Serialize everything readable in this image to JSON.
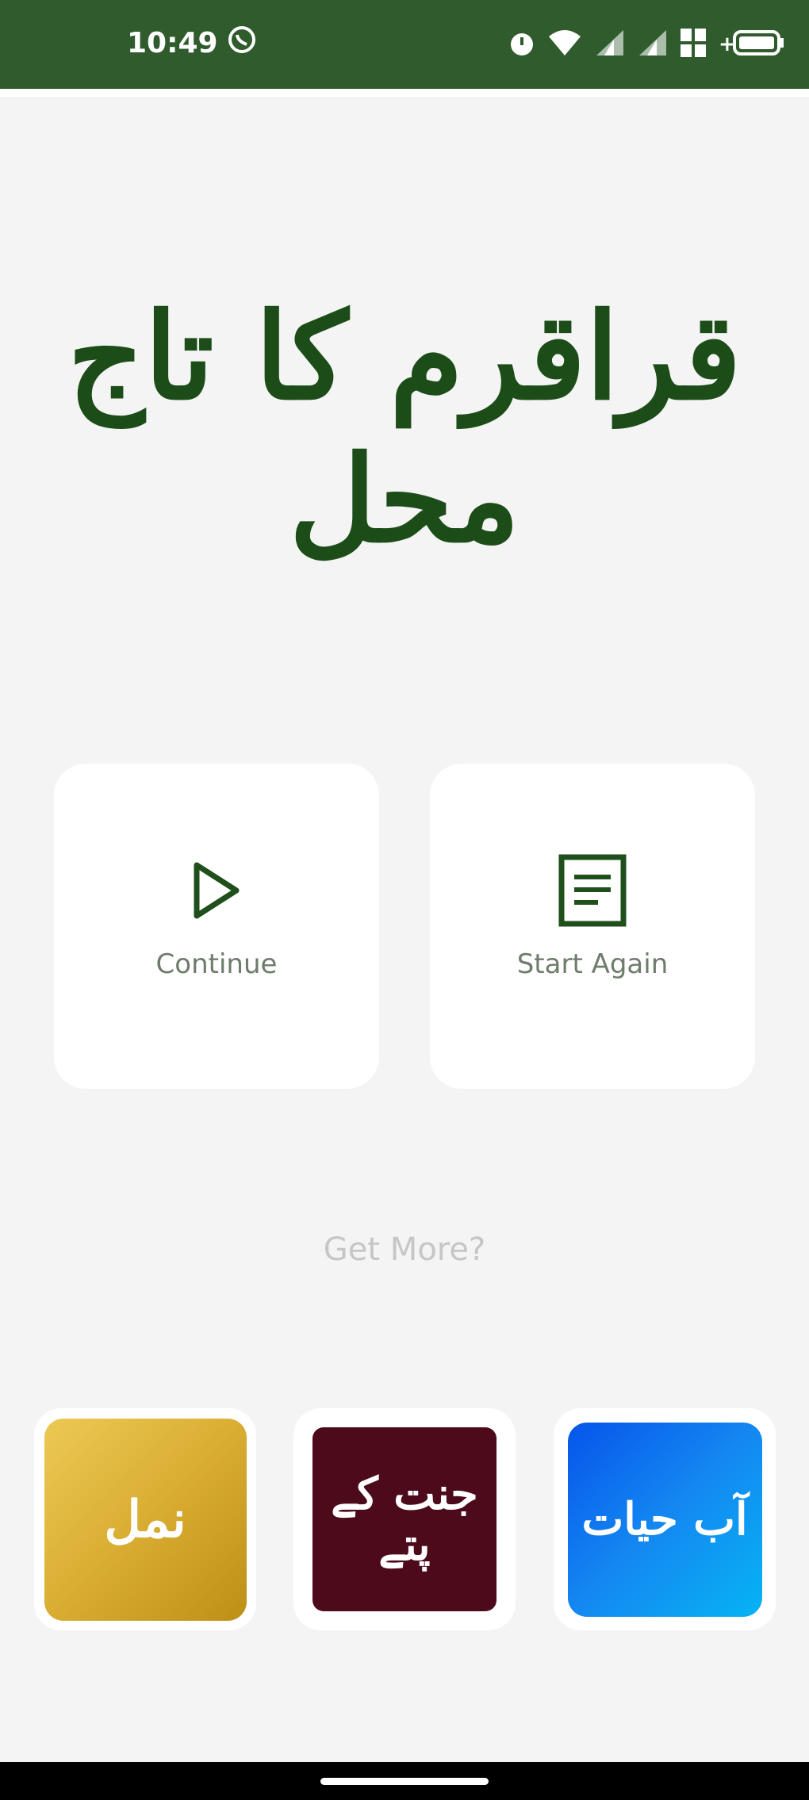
{
  "status_bar": {
    "time": "10:49",
    "icons": [
      "whatsapp-icon",
      "alarm-icon",
      "wifi-icon",
      "signal-icon",
      "signal-icon",
      "data-icon",
      "battery-icon"
    ]
  },
  "app": {
    "title": "قراقرم کا تاج محل"
  },
  "actions": {
    "continue_label": "Continue",
    "start_again_label": "Start Again"
  },
  "more": {
    "label": "Get More?"
  },
  "more_apps": [
    {
      "label": "نمل",
      "icon": "namal-app-icon"
    },
    {
      "label": "جنت کے پتے",
      "icon": "jannat-kay-pattay-app-icon"
    },
    {
      "label": "آب حیات",
      "icon": "aab-e-hayat-app-icon"
    }
  ],
  "colors": {
    "status_bar": "#2f5b2d",
    "accent": "#1c4d18",
    "background": "#f4f4f4",
    "card": "#ffffff",
    "tile_gold": "#d9ad32",
    "tile_maroon": "#4c0a1b",
    "tile_blue": "#1488f1"
  }
}
